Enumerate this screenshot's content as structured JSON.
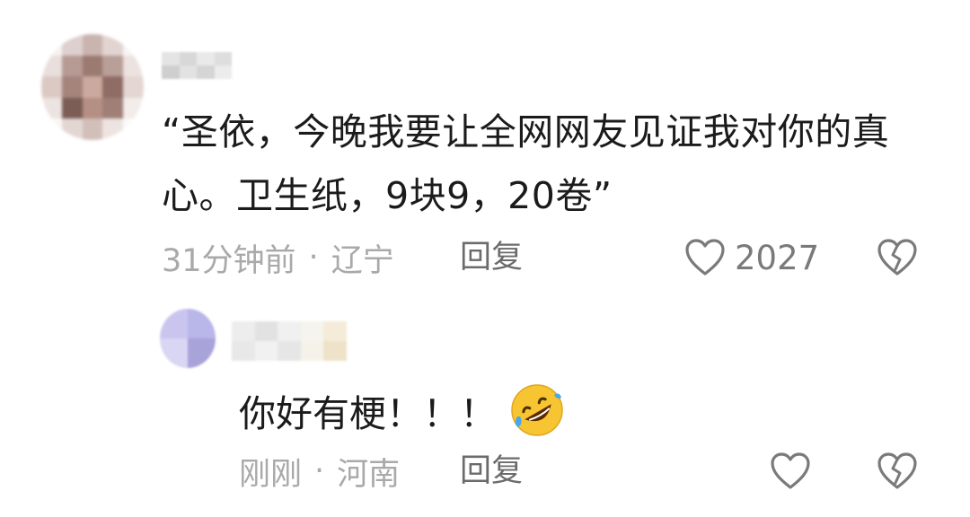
{
  "comment": {
    "text": "“圣依，今晚我要让全网网友见证我对你的真心。卫生纸，9块9，20卷”",
    "time": "31分钟前",
    "separator": "·",
    "location": "辽宁",
    "reply_label": "回复",
    "like_count": "2027",
    "like_icon": "heart-outline-icon",
    "dislike_icon": "broken-heart-icon"
  },
  "reply": {
    "text": "你好有梗！！！",
    "emoji": "rolling-on-floor-laughing-emoji",
    "time": "刚刚",
    "separator": "·",
    "location": "河南",
    "reply_label": "回复",
    "like_icon": "heart-outline-icon",
    "dislike_icon": "broken-heart-icon"
  },
  "colors": {
    "text_primary": "#1b1b1b",
    "text_meta": "#a9a9a9",
    "text_action": "#6b6b6b",
    "icon": "#7a7a7a",
    "emoji_yellow": "#f7c531",
    "emoji_tear": "#4aa8e8"
  }
}
